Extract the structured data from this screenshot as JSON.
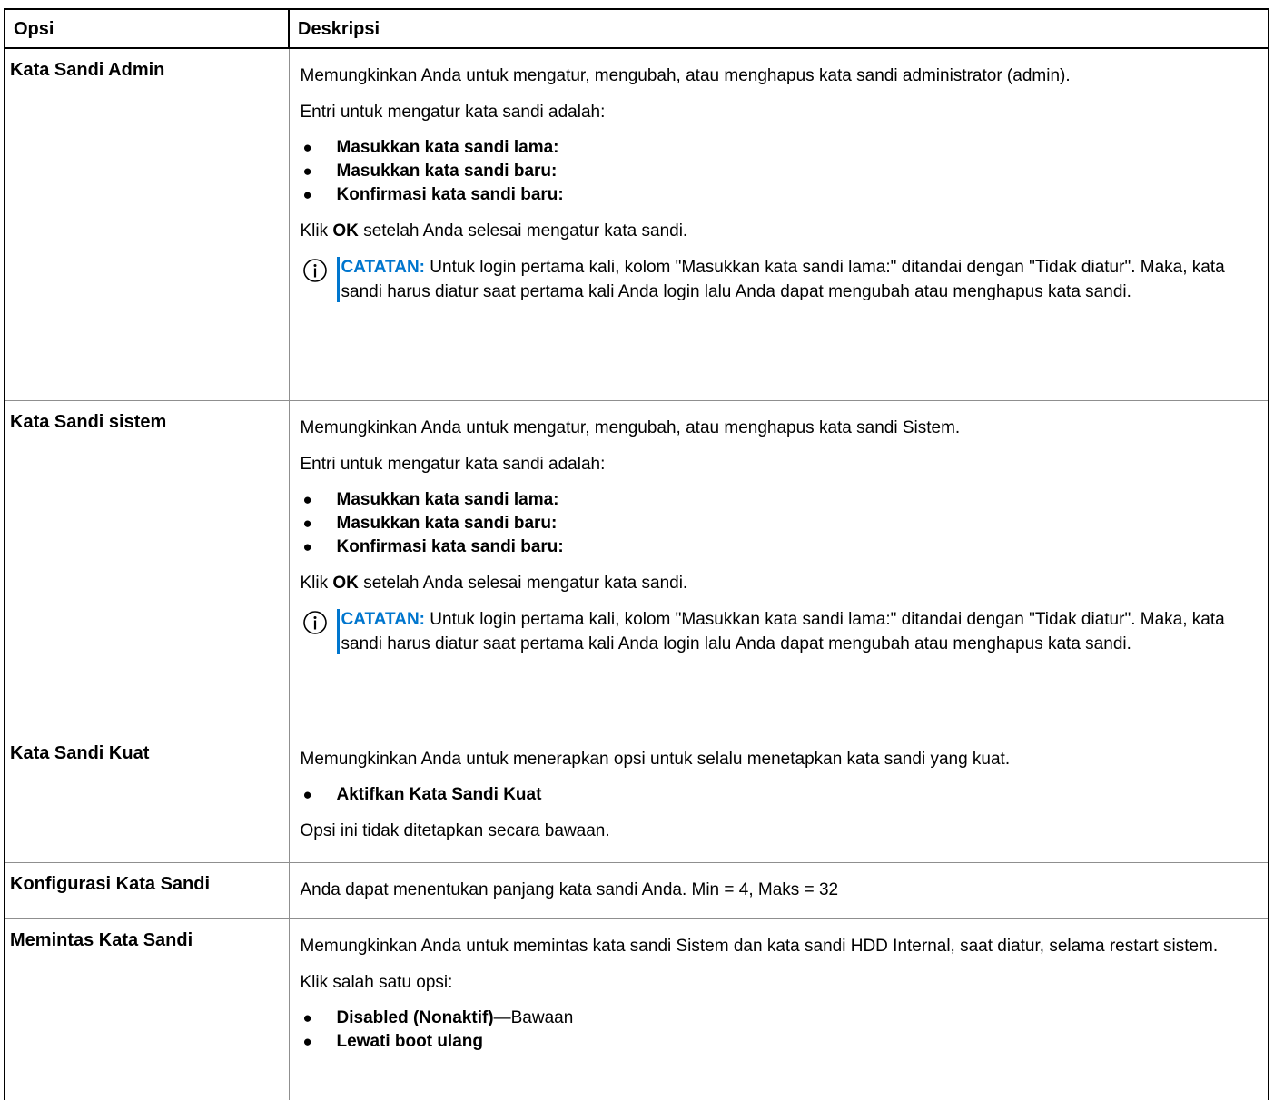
{
  "header": {
    "col1": "Opsi",
    "col2": "Deskripsi"
  },
  "common": {
    "entries_intro": "Entri untuk mengatur kata sandi adalah:",
    "old_password": "Masukkan kata sandi lama:",
    "new_password": "Masukkan kata sandi baru:",
    "confirm_password": "Konfirmasi kata sandi baru:",
    "click_prefix": "Klik",
    "click_ok": "OK",
    "click_suffix": "setelah Anda selesai mengatur kata sandi.",
    "note_label": "CATATAN:",
    "note_text": "Untuk login pertama kali, kolom \"Masukkan kata sandi lama:\" ditandai dengan \"Tidak diatur\". Maka, kata sandi harus diatur saat pertama kali Anda login lalu Anda dapat mengubah atau menghapus kata sandi.",
    "note_icon": "info-circle-icon",
    "accent_color": "#0076ce",
    "bullet_glyph": "●"
  },
  "rows": [
    {
      "option": "Kata Sandi Admin",
      "description": "Memungkinkan Anda untuk mengatur, mengubah, atau menghapus kata sandi administrator (admin)."
    },
    {
      "option": "Kata Sandi sistem",
      "description": "Memungkinkan Anda untuk mengatur, mengubah, atau menghapus kata sandi Sistem."
    },
    {
      "option": "Kata Sandi Kuat",
      "description": "Memungkinkan Anda untuk menerapkan opsi untuk selalu menetapkan kata sandi yang kuat.",
      "bullet": "Aktifkan Kata Sandi Kuat",
      "default_note": "Opsi ini tidak ditetapkan secara bawaan."
    },
    {
      "option": "Konfigurasi Kata Sandi",
      "description": "Anda dapat menentukan panjang kata sandi Anda. Min = 4, Maks = 32"
    },
    {
      "option": "Memintas Kata Sandi",
      "description": "Memungkinkan Anda untuk memintas kata sandi Sistem dan kata sandi HDD Internal, saat diatur, selama restart sistem.",
      "intro": "Klik salah satu opsi:",
      "bullets": [
        {
          "label": "Disabled (Nonaktif)",
          "suffix": "—Bawaan"
        },
        {
          "label": "Lewati boot ulang"
        }
      ]
    }
  ]
}
